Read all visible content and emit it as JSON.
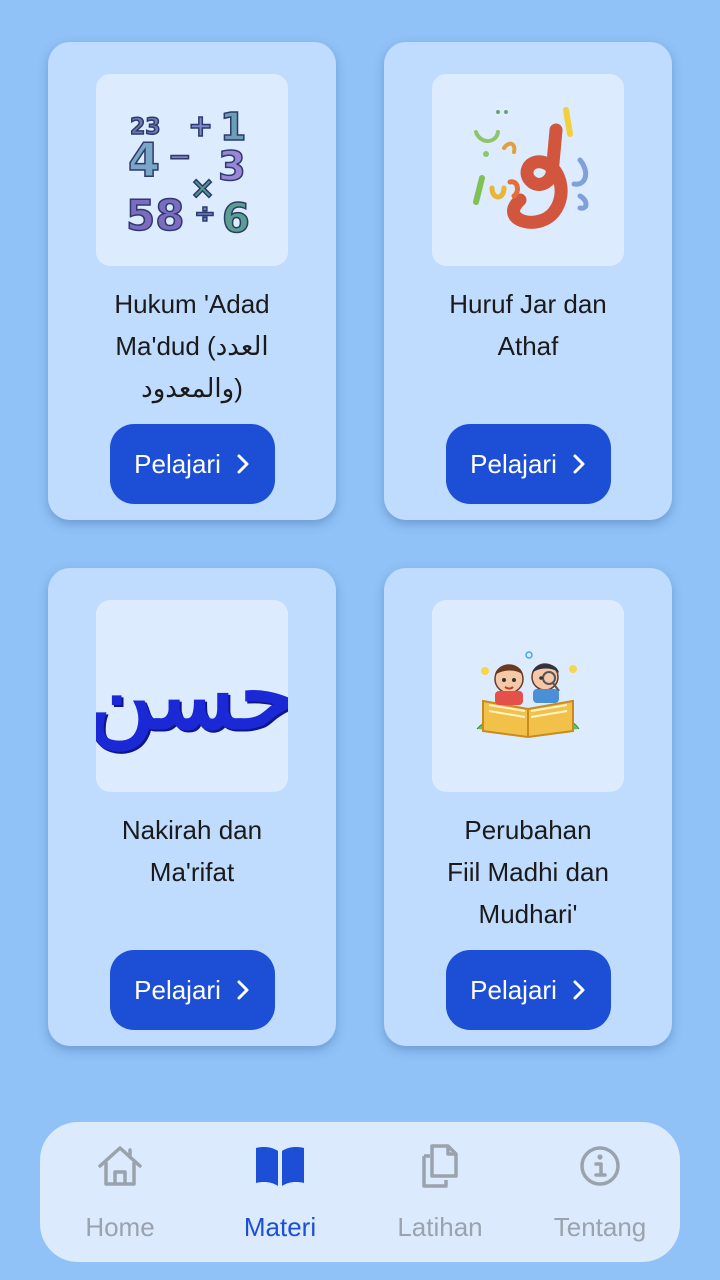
{
  "cards": [
    {
      "title": "Hukum 'Adad\nMa'dud (العدد\nوالمعدود)",
      "button_label": "Pelajari",
      "image": "numbers-math-image"
    },
    {
      "title": "Huruf Jar dan\nAthaf",
      "button_label": "Pelajari",
      "image": "arabic-letters-image"
    },
    {
      "title": "Nakirah dan\nMa'rifat",
      "button_label": "Pelajari",
      "image": "arabic-calligraphy-image",
      "calligraphy": "حسن"
    },
    {
      "title": "Perubahan\nFiil Madhi dan\nMudhari'",
      "button_label": "Pelajari",
      "image": "kids-reading-book-image"
    }
  ],
  "nav": {
    "items": [
      {
        "label": "Home",
        "icon": "home-icon",
        "active": false
      },
      {
        "label": "Materi",
        "icon": "book-icon",
        "active": true
      },
      {
        "label": "Latihan",
        "icon": "copy-documents-icon",
        "active": false
      },
      {
        "label": "Tentang",
        "icon": "info-icon",
        "active": false
      }
    ]
  },
  "colors": {
    "background": "#90c2f8",
    "card": "#bfdbfd",
    "thumb": "#dcebfe",
    "button": "#1d4fd6",
    "nav_active": "#1d4fd6",
    "nav_inactive": "#9aa3ad"
  }
}
